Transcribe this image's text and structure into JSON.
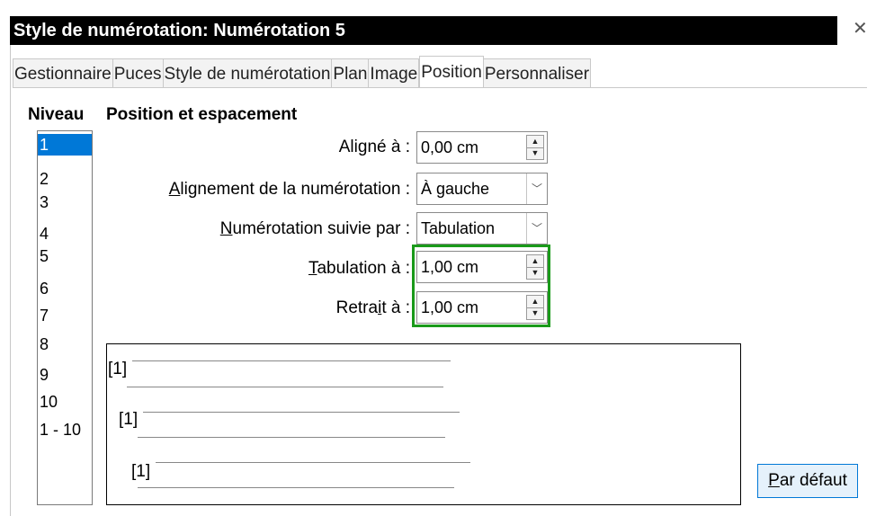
{
  "window": {
    "title": "Style de numérotation: Numérotation 5",
    "close_glyph": "✕"
  },
  "tabs": [
    {
      "label": "Gestionnaire"
    },
    {
      "label": "Puces"
    },
    {
      "label": "Style de numérotation"
    },
    {
      "label": "Plan"
    },
    {
      "label": "Image"
    },
    {
      "label": "Position",
      "active": true
    },
    {
      "label": "Personnaliser"
    }
  ],
  "level": {
    "heading": "Niveau",
    "items": [
      "1",
      "2",
      "3",
      "4",
      "5",
      "6",
      "7",
      "8",
      "9",
      "10",
      "1 - 10"
    ],
    "selected": "1"
  },
  "position": {
    "heading": "Position et espacement",
    "aligned_at": {
      "label_pre": "Ali",
      "label_u": "g",
      "label_post": "né à :",
      "value": "0,00 cm"
    },
    "numbering_alignment": {
      "label_pre": "",
      "label_u": "A",
      "label_post": "lignement de la numérotation :",
      "value": "À gauche"
    },
    "numbering_followed_by": {
      "label_pre": "",
      "label_u": "N",
      "label_post": "umérotation suivie par :",
      "value": "Tabulation"
    },
    "tab_stop_at": {
      "label_pre": "",
      "label_u": "T",
      "label_post": "abulation à :",
      "value": "1,00 cm"
    },
    "indent_at": {
      "label_pre": "Retra",
      "label_u": "i",
      "label_post": "t à :",
      "value": "1,00 cm"
    }
  },
  "preview": {
    "line1": "[1]",
    "line2": "[1]",
    "line3": "[1]"
  },
  "buttons": {
    "default_u": "P",
    "default_rest": "ar défaut"
  },
  "colors": {
    "selection": "#0078d7",
    "highlight_box": "#1a9a1a"
  }
}
